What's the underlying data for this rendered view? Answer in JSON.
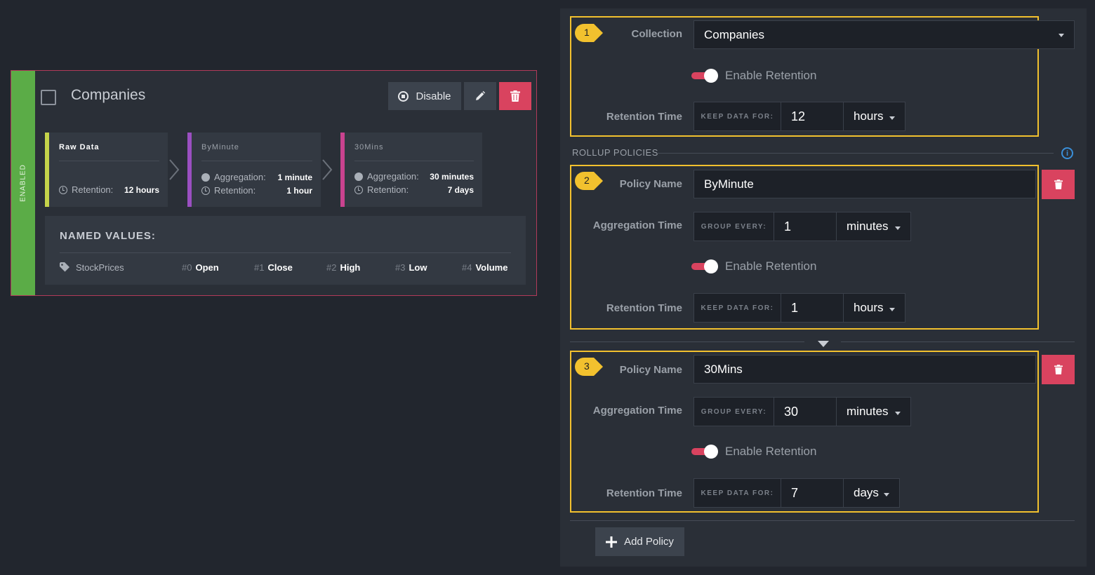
{
  "card": {
    "status": "ENABLED",
    "title": "Companies",
    "disable_label": "Disable",
    "stages": [
      {
        "name": "Raw Data",
        "color": "#c5d34a",
        "retention_label": "Retention:",
        "retention": "12 hours"
      },
      {
        "name": "ByMinute",
        "color": "#9b4fc1",
        "aggregation_label": "Aggregation:",
        "aggregation": "1 minute",
        "retention_label": "Retention:",
        "retention": "1 hour"
      },
      {
        "name": "30Mins",
        "color": "#c9438f",
        "aggregation_label": "Aggregation:",
        "aggregation": "30 minutes",
        "retention_label": "Retention:",
        "retention": "7 days"
      }
    ],
    "named_values": {
      "heading": "NAMED VALUES:",
      "tag": "StockPrices",
      "items": [
        {
          "index": "#0",
          "name": "Open"
        },
        {
          "index": "#1",
          "name": "Close"
        },
        {
          "index": "#2",
          "name": "High"
        },
        {
          "index": "#3",
          "name": "Low"
        },
        {
          "index": "#4",
          "name": "Volume"
        }
      ]
    }
  },
  "panel": {
    "collection_label": "Collection",
    "collection_value": "Companies",
    "enable_retention_label": "Enable Retention",
    "retention_time_label": "Retention Time",
    "keep_data_for": "KEEP DATA FOR:",
    "retention_value": "12",
    "retention_unit": "hours",
    "rollup_title": "ROLLUP POLICIES",
    "info_icon": "i",
    "policy_name_label": "Policy Name",
    "aggregation_time_label": "Aggregation Time",
    "group_every": "GROUP EVERY:",
    "policies": [
      {
        "badge": "2",
        "name": "ByMinute",
        "group_value": "1",
        "group_unit": "minutes",
        "enable_retention": "Enable Retention",
        "keep_value": "1",
        "keep_unit": "hours"
      },
      {
        "badge": "3",
        "name": "30Mins",
        "group_value": "30",
        "group_unit": "minutes",
        "enable_retention": "Enable Retention",
        "keep_value": "7",
        "keep_unit": "days"
      }
    ],
    "badge_1": "1",
    "add_policy_label": "Add Policy"
  },
  "colors": {
    "highlight": "#f2c12e",
    "danger": "#d9435f",
    "enabled": "#5bac47",
    "info": "#3a8fd9"
  }
}
